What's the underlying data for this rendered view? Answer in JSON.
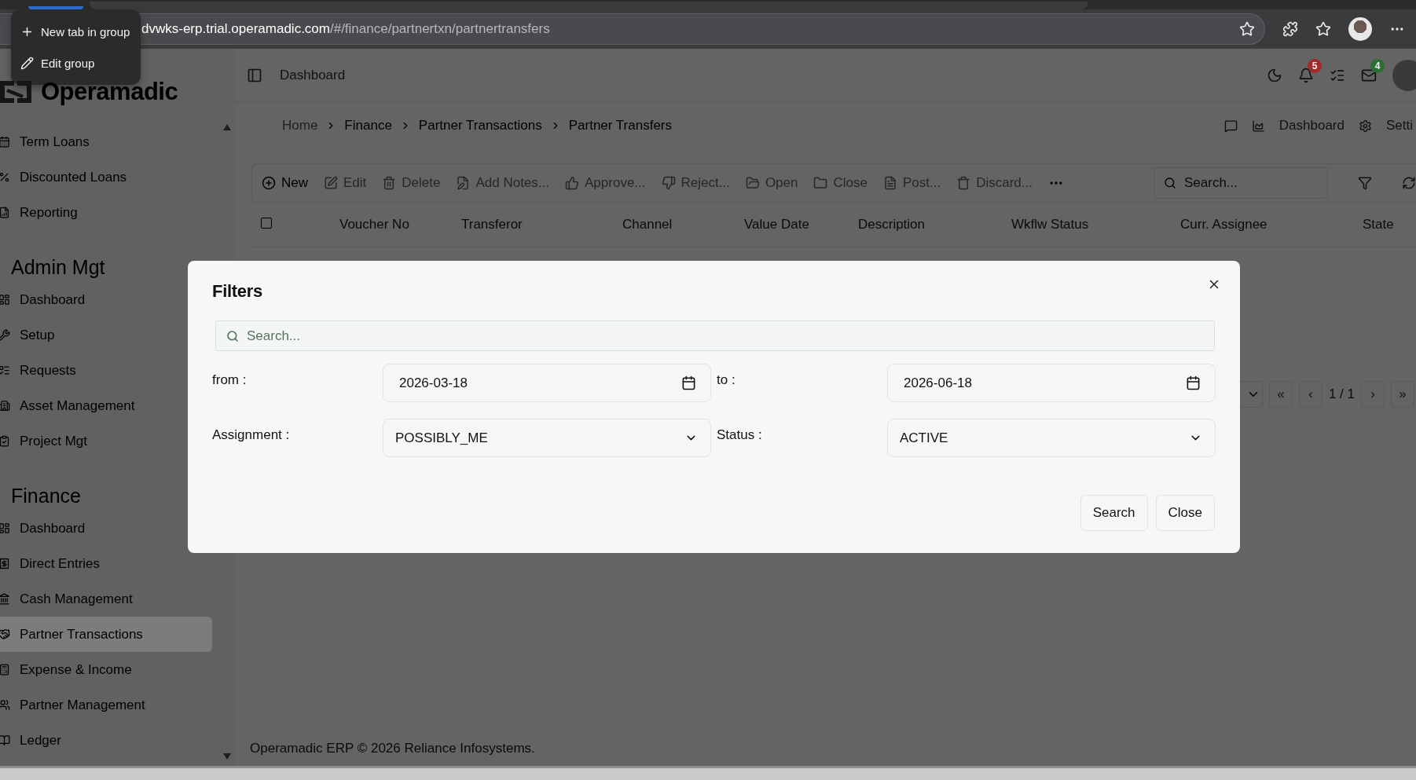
{
  "browser": {
    "url_host": "dvwks-erp.trial.operamadic.com",
    "url_path": "/#/finance/partnertxn/partnertransfers"
  },
  "tab_group_menu": {
    "items": [
      {
        "kind": "new",
        "label": "New tab in group"
      },
      {
        "kind": "edit",
        "label": "Edit group"
      }
    ]
  },
  "logo": {
    "text": "Operamadic"
  },
  "header": {
    "title": "Dashboard",
    "icons": [
      {
        "kind": "theme"
      },
      {
        "kind": "bell",
        "badge": "5",
        "color": "#a32a2a"
      },
      {
        "kind": "tasks"
      },
      {
        "kind": "mail",
        "badge": "4",
        "color": "#2a6e34"
      },
      {
        "kind": "avatar"
      }
    ]
  },
  "sidebar": {
    "sections": [
      {
        "items": [
          {
            "kind": "calendar",
            "label": "Term Loans",
            "selected": false
          },
          {
            "kind": "percent",
            "label": "Discounted Loans",
            "selected": false
          },
          {
            "kind": "report",
            "label": "Reporting",
            "selected": false
          }
        ]
      },
      {
        "heading": "Admin Mgt",
        "items": [
          {
            "kind": "dashboard",
            "label": "Dashboard",
            "selected": false
          },
          {
            "kind": "setup",
            "label": "Setup",
            "selected": false
          },
          {
            "kind": "requests",
            "label": "Requests",
            "selected": false
          },
          {
            "kind": "asset",
            "label": "Asset Management",
            "selected": false
          },
          {
            "kind": "project",
            "label": "Project Mgt",
            "selected": false
          }
        ]
      },
      {
        "heading": "Finance",
        "items": [
          {
            "kind": "dashboard",
            "label": "Dashboard",
            "selected": false
          },
          {
            "kind": "entries",
            "label": "Direct Entries",
            "selected": false
          },
          {
            "kind": "cash",
            "label": "Cash Management",
            "selected": false
          },
          {
            "kind": "partner",
            "label": "Partner Transactions",
            "selected": true
          },
          {
            "kind": "calculator",
            "label": "Expense & Income",
            "selected": false
          },
          {
            "kind": "people",
            "label": "Partner Management",
            "selected": false
          },
          {
            "kind": "ledger",
            "label": "Ledger",
            "selected": false
          }
        ]
      }
    ]
  },
  "breadcrumb": [
    "Home",
    "Finance",
    "Partner Transactions",
    "Partner Transfers"
  ],
  "page_links": [
    {
      "kind": "comments"
    },
    {
      "kind": "dashboard",
      "label": "Dashboard"
    },
    {
      "kind": "settings",
      "label": "Setti"
    }
  ],
  "toolbar": {
    "actions": [
      {
        "kind": "new",
        "label": "New",
        "disabled": false
      },
      {
        "kind": "edit",
        "label": "Edit",
        "disabled": true
      },
      {
        "kind": "delete",
        "label": "Delete",
        "disabled": true
      },
      {
        "kind": "notes",
        "label": "Add Notes...",
        "disabled": true
      },
      {
        "kind": "approve",
        "label": "Approve...",
        "disabled": true
      },
      {
        "kind": "reject",
        "label": "Reject...",
        "disabled": true
      },
      {
        "kind": "open",
        "label": "Open",
        "disabled": true
      },
      {
        "kind": "close",
        "label": "Close",
        "disabled": true
      },
      {
        "kind": "post",
        "label": "Post...",
        "disabled": true
      },
      {
        "kind": "discard",
        "label": "Discard...",
        "disabled": true
      }
    ],
    "search": {
      "placeholder": "Search..."
    }
  },
  "table": {
    "header_checked": false,
    "columns": [
      "Voucher No",
      "Transferor",
      "Channel",
      "Value Date",
      "Description",
      "Wkflw Status",
      "Curr. Assignee",
      "State"
    ]
  },
  "pagination": {
    "first": "«",
    "prev": "‹",
    "page": "1 / 1",
    "next": "›",
    "last": "»"
  },
  "footer": "Operamadic ERP © 2026 Reliance Infosystems.",
  "filters_dialog": {
    "title": "Filters",
    "search": {
      "placeholder": "Search..."
    },
    "fields": [
      {
        "kind": "date",
        "label": "from :",
        "value": "2026-03-18"
      },
      {
        "kind": "date",
        "label": "to :",
        "value": "2026-06-18"
      },
      {
        "kind": "select",
        "label": "Assignment :",
        "value": "POSSIBLY_ME"
      },
      {
        "kind": "select",
        "label": "Status :",
        "value": "ACTIVE"
      }
    ],
    "buttons": [
      "Search",
      "Close"
    ]
  }
}
